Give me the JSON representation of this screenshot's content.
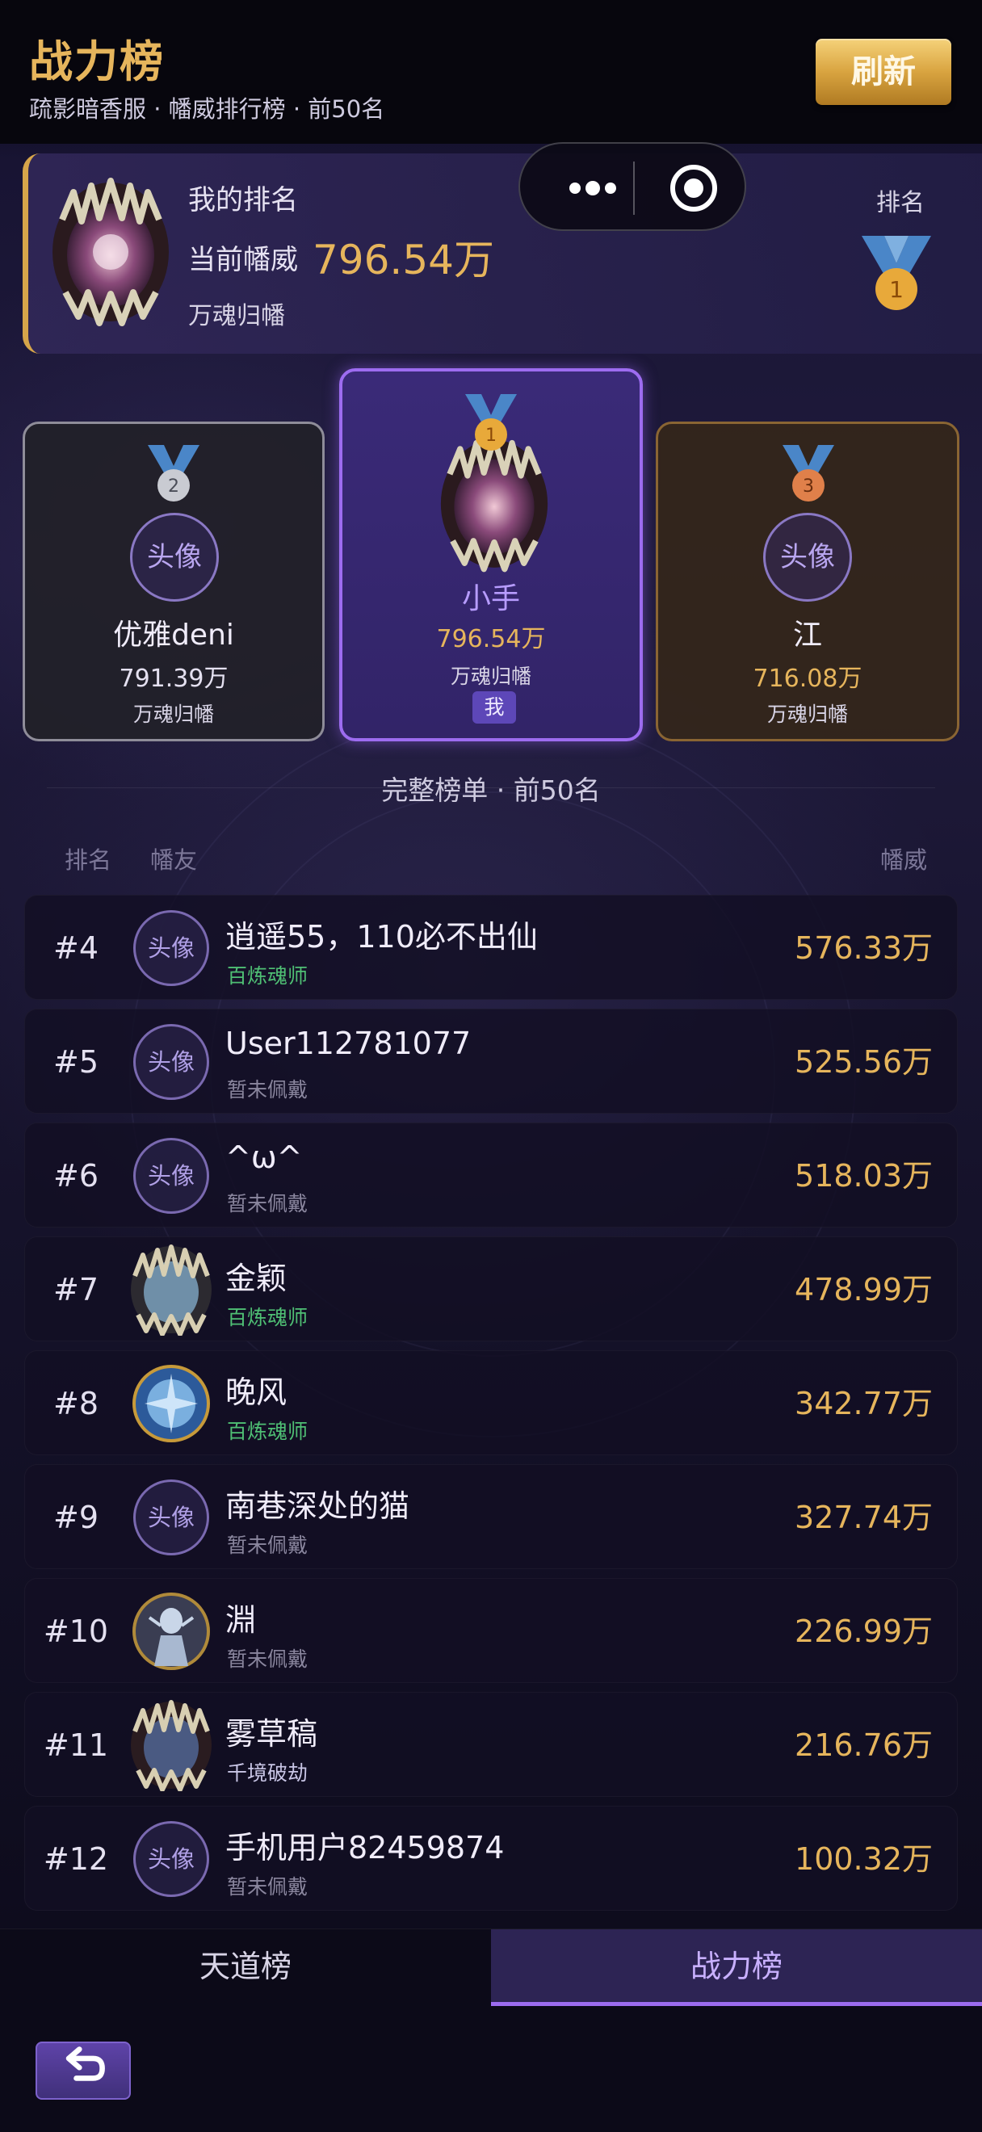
{
  "header": {
    "title": "战力榜",
    "subtitle": "疏影暗香服 · 幡威排行榜 · 前50名",
    "refresh_label": "刷新"
  },
  "my_rank": {
    "label": "我的排名",
    "power_label": "当前幡威",
    "power_value": "796.54万",
    "title": "万魂归幡",
    "rank_label": "排名",
    "rank_number": "1"
  },
  "podium": {
    "first": {
      "medal": "1",
      "name": "小手",
      "power": "796.54万",
      "title": "万魂归幡",
      "badge": "我"
    },
    "second": {
      "medal": "2",
      "avatar_text": "头像",
      "name": "优雅deni",
      "power": "791.39万",
      "title": "万魂归幡"
    },
    "third": {
      "medal": "3",
      "avatar_text": "头像",
      "name": "江",
      "power": "716.08万",
      "title": "万魂归幡"
    }
  },
  "list": {
    "section_title": "完整榜单 · 前50名",
    "col_rank": "排名",
    "col_friend": "幡友",
    "col_power": "幡威",
    "rows": [
      {
        "rank": "#4",
        "avatar_text": "头像",
        "name": "逍遥55，110必不出仙",
        "title": "百炼魂师",
        "power": "576.33万"
      },
      {
        "rank": "#5",
        "avatar_text": "头像",
        "name": "User112781077",
        "title": "暂未佩戴",
        "power": "525.56万"
      },
      {
        "rank": "#6",
        "avatar_text": "头像",
        "name": "^ω^",
        "title": "暂未佩戴",
        "power": "518.03万"
      },
      {
        "rank": "#7",
        "name": "金颖",
        "title": "百炼魂师",
        "power": "478.99万"
      },
      {
        "rank": "#8",
        "name": "晚风",
        "title": "百炼魂师",
        "power": "342.77万"
      },
      {
        "rank": "#9",
        "avatar_text": "头像",
        "name": "南巷深处的猫",
        "title": "暂未佩戴",
        "power": "327.74万"
      },
      {
        "rank": "#10",
        "name": "淵",
        "title": "暂未佩戴",
        "power": "226.99万"
      },
      {
        "rank": "#11",
        "name": "雾草稿",
        "title": "千境破劫",
        "power": "216.76万"
      },
      {
        "rank": "#12",
        "avatar_text": "头像",
        "name": "手机用户82459874",
        "title": "暂未佩戴",
        "power": "100.32万"
      }
    ]
  },
  "tabs": [
    {
      "label": "天道榜",
      "active": false
    },
    {
      "label": "战力榜",
      "active": true
    }
  ],
  "colors": {
    "gold": "#e6b55c",
    "purple_accent": "#9d6cf0",
    "title_green": "#4fbf74",
    "title_gray": "#8a869e",
    "title_blue": "#c9c6e6"
  },
  "icons": {
    "capsule_more": "more-dots-icon",
    "capsule_target": "target-icon",
    "back": "return-arrow-icon",
    "medal": "medal-icon"
  }
}
